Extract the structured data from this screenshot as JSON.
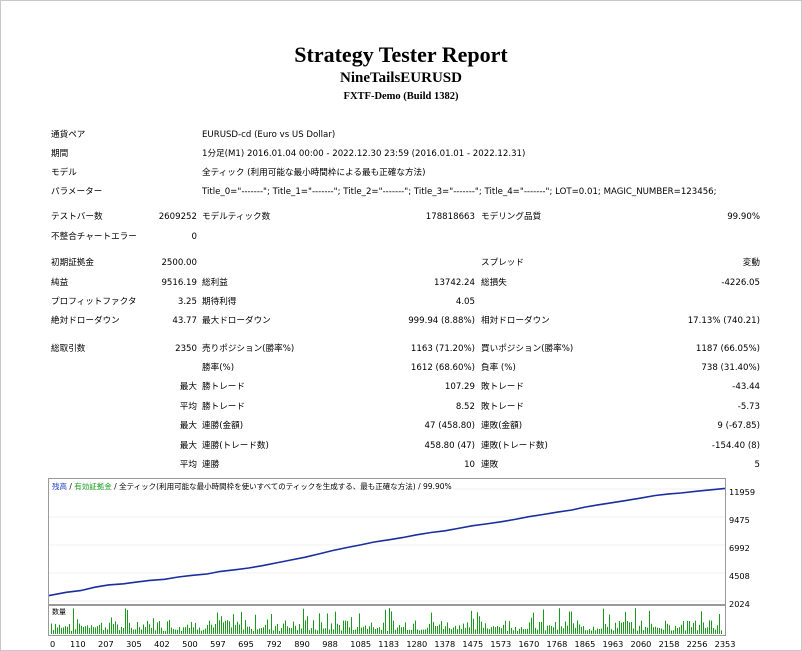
{
  "report": {
    "title": "Strategy Tester Report",
    "expert": "NineTailsEURUSD",
    "server": "FXTF-Demo (Build 1382)"
  },
  "info": [
    {
      "label": "通貨ペア",
      "value": "EURUSD-cd (Euro vs US Dollar)"
    },
    {
      "label": "期間",
      "value": "1分足(M1) 2016.01.04 00:00 - 2022.12.30 23:59 (2016.01.01 - 2022.12.31)"
    },
    {
      "label": "モデル",
      "value": "全ティック (利用可能な最小時間枠による最も正確な方法)"
    },
    {
      "label": "パラメーター",
      "value": "Title_0=\"-------\"; Title_1=\"-------\"; Title_2=\"-------\"; Title_3=\"-------\"; Title_4=\"-------\"; LOT=0.01; MAGIC_NUMBER=123456;"
    }
  ],
  "stats": {
    "bars_label": "テストバー数",
    "bars": "2609252",
    "ticks_label": "モデルティック数",
    "ticks": "178818663",
    "quality_label": "モデリング品質",
    "quality": "99.90%",
    "errors_label": "不整合チャートエラー",
    "errors": "0",
    "deposit_label": "初期証拠金",
    "deposit": "2500.00",
    "spread_label": "スプレッド",
    "spread": "変動",
    "net_label": "純益",
    "net": "9516.19",
    "gross_profit_label": "総利益",
    "gross_profit": "13742.24",
    "gross_loss_label": "総損失",
    "gross_loss": "-4226.05",
    "pf_label": "プロフィットファクタ",
    "pf": "3.25",
    "payoff_label": "期待利得",
    "payoff": "4.05",
    "abs_dd_label": "絶対ドローダウン",
    "abs_dd": "43.77",
    "max_dd_label": "最大ドローダウン",
    "max_dd": "999.94 (8.88%)",
    "rel_dd_label": "相対ドローダウン",
    "rel_dd": "17.13% (740.21)",
    "trades_label": "総取引数",
    "trades": "2350",
    "short_label": "売りポジション(勝率%)",
    "short": "1163 (71.20%)",
    "long_label": "買いポジション(勝率%)",
    "long": "1187 (66.05%)",
    "win_label": "勝率(%)",
    "win": "1612 (68.60%)",
    "loss_label": "負率 (%)",
    "loss": "738 (31.40%)",
    "max_word": "最大",
    "avg_word": "平均",
    "largest_win_label": "勝トレード",
    "largest_win": "107.29",
    "largest_loss_label": "敗トレード",
    "largest_loss": "-43.44",
    "avg_win_label": "勝トレード",
    "avg_win": "8.52",
    "avg_loss_label": "敗トレード",
    "avg_loss": "-5.73",
    "cons_wins_money_label": "連勝(金額)",
    "cons_wins_money": "47 (458.80)",
    "cons_loss_money_label": "連敗(金額)",
    "cons_loss_money": "9 (-67.85)",
    "cons_profit_label": "連勝(トレード数)",
    "cons_profit": "458.80 (47)",
    "cons_loss_label": "連敗(トレード数)",
    "cons_loss": "-154.40 (8)",
    "avg_cons_wins_label": "連勝",
    "avg_cons_wins": "10",
    "avg_cons_loss_label": "連敗",
    "avg_cons_loss": "5"
  },
  "chart": {
    "legend_balance": "残高",
    "sep1": " / ",
    "legend_equity": "有効証拠金",
    "legend_rest": " / 全ティック(利用可能な最小時間枠を使いすべてのティックを生成する、最も正確な方法) / 99.90%",
    "volume_label": "数量",
    "y_ticks": [
      "11959",
      "9475",
      "6992",
      "4508",
      "2024"
    ],
    "x_ticks": [
      "0",
      "110",
      "207",
      "305",
      "402",
      "500",
      "597",
      "695",
      "792",
      "890",
      "988",
      "1085",
      "1183",
      "1280",
      "1378",
      "1475",
      "1573",
      "1670",
      "1768",
      "1865",
      "1963",
      "2060",
      "2158",
      "2256",
      "2353"
    ],
    "balance_color": "#1a2ea0",
    "volume_color": "#1a9a1a"
  },
  "chart_data": {
    "type": "line",
    "ylim": [
      2024,
      11959
    ],
    "xlim": [
      0,
      2353
    ],
    "series": [
      {
        "values": [
          [
            0,
            2500
          ],
          [
            60,
            2800
          ],
          [
            110,
            2950
          ],
          [
            160,
            3250
          ],
          [
            207,
            3450
          ],
          [
            260,
            3550
          ],
          [
            305,
            3700
          ],
          [
            350,
            3850
          ],
          [
            402,
            3950
          ],
          [
            450,
            4150
          ],
          [
            500,
            4300
          ],
          [
            550,
            4420
          ],
          [
            597,
            4650
          ],
          [
            650,
            4800
          ],
          [
            695,
            4950
          ],
          [
            740,
            5150
          ],
          [
            792,
            5400
          ],
          [
            840,
            5650
          ],
          [
            890,
            5900
          ],
          [
            940,
            6200
          ],
          [
            988,
            6500
          ],
          [
            1040,
            6780
          ],
          [
            1085,
            7000
          ],
          [
            1130,
            7250
          ],
          [
            1183,
            7450
          ],
          [
            1230,
            7650
          ],
          [
            1280,
            7900
          ],
          [
            1330,
            8100
          ],
          [
            1378,
            8250
          ],
          [
            1420,
            8450
          ],
          [
            1475,
            8700
          ],
          [
            1520,
            8850
          ],
          [
            1573,
            9050
          ],
          [
            1620,
            9250
          ],
          [
            1670,
            9500
          ],
          [
            1720,
            9700
          ],
          [
            1768,
            9900
          ],
          [
            1820,
            10100
          ],
          [
            1865,
            10350
          ],
          [
            1910,
            10550
          ],
          [
            1963,
            10750
          ],
          [
            2010,
            10950
          ],
          [
            2060,
            11150
          ],
          [
            2110,
            11380
          ],
          [
            2158,
            11520
          ],
          [
            2200,
            11600
          ],
          [
            2256,
            11760
          ],
          [
            2300,
            11880
          ],
          [
            2353,
            12016
          ]
        ]
      }
    ]
  }
}
